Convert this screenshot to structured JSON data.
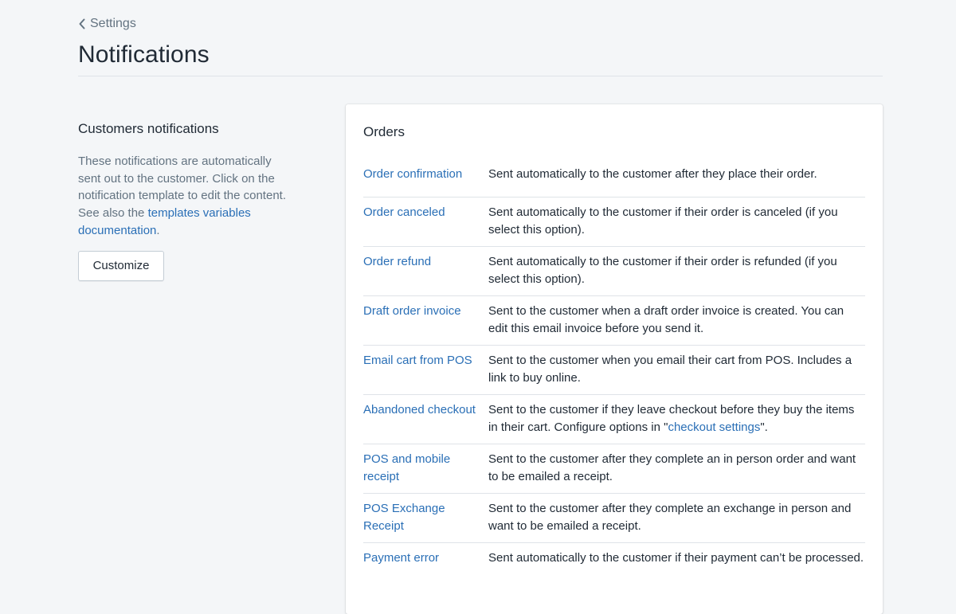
{
  "breadcrumb": {
    "label": "Settings"
  },
  "page": {
    "title": "Notifications"
  },
  "annotation": {
    "title": "Customers notifications",
    "description": "These notifications are automatically sent out to the customer. Click on the notification template to edit the content. See also the ",
    "link_text": "templates variables documentation",
    "description_end": ".",
    "customize_label": "Customize"
  },
  "orders": {
    "title": "Orders",
    "rows": [
      {
        "name": "Order confirmation",
        "desc": "Sent automatically to the customer after they place their order."
      },
      {
        "name": "Order canceled",
        "desc": "Sent automatically to the customer if their order is canceled (if you select this option)."
      },
      {
        "name": "Order refund",
        "desc": "Sent automatically to the customer if their order is refunded (if you select this option)."
      },
      {
        "name": "Draft order invoice",
        "desc": "Sent to the customer when a draft order invoice is created. You can edit this email invoice before you send it."
      },
      {
        "name": "Email cart from POS",
        "desc": "Sent to the customer when you email their cart from POS. Includes a link to buy online."
      },
      {
        "name": "Abandoned checkout",
        "desc": "Sent to the customer if they leave checkout before they buy the items in their cart. Configure options in \"",
        "link": "checkout settings",
        "desc_end": "\"."
      },
      {
        "name": "POS and mobile receipt",
        "desc": "Sent to the customer after they complete an in person order and want to be emailed a receipt."
      },
      {
        "name": "POS Exchange Receipt",
        "desc": "Sent to the customer after they complete an exchange in person and want to be emailed a receipt."
      },
      {
        "name": "Payment error",
        "desc": "Sent automatically to the customer if their payment can’t be processed."
      }
    ]
  },
  "colors": {
    "background": "#f4f6f8",
    "link": "#2a6fb6",
    "text": "#212b36",
    "muted": "#637381",
    "divider": "#dfe3e8"
  }
}
